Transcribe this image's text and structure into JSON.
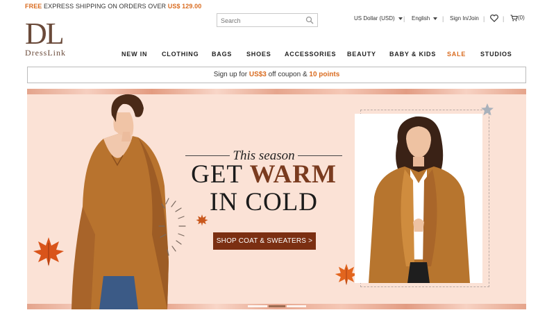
{
  "topbar": {
    "free": "FREE",
    "text": "EXPRESS SHIPPING ON ORDERS OVER",
    "amount": "US$ 129.00"
  },
  "logo": {
    "mark": "DL",
    "text": "DressLink"
  },
  "search": {
    "placeholder": "Search",
    "icon": "search-icon"
  },
  "utilities": {
    "currency": "US Dollar (USD)",
    "language": "English",
    "account": "Sign In/Join",
    "cart_count": "(0)",
    "wishlist_icon": "heart-icon",
    "cart_icon": "cart-icon"
  },
  "nav": [
    {
      "label": "NEW IN"
    },
    {
      "label": "CLOTHING"
    },
    {
      "label": "BAGS"
    },
    {
      "label": "SHOES"
    },
    {
      "label": "ACCESSORIES"
    },
    {
      "label": "BEAUTY"
    },
    {
      "label": "BABY & KIDS"
    },
    {
      "label": "SALE"
    },
    {
      "label": "STUDIOS"
    }
  ],
  "signup": {
    "prefix": "Sign up for",
    "coupon": "US$3",
    "middle": "off coupon &",
    "points": "10 points"
  },
  "banner": {
    "small_title": "This season",
    "line1_a": "GET",
    "line1_b": "WARM",
    "line2": "IN COLD",
    "cta": "SHOP COAT & SWEATERS >",
    "slides": 3,
    "active_slide": 2
  },
  "colors": {
    "accent": "#d96b1f",
    "brand": "#6a4a3a",
    "cta_bg": "#7b2f12",
    "banner_bg": "#fbe2d6"
  }
}
